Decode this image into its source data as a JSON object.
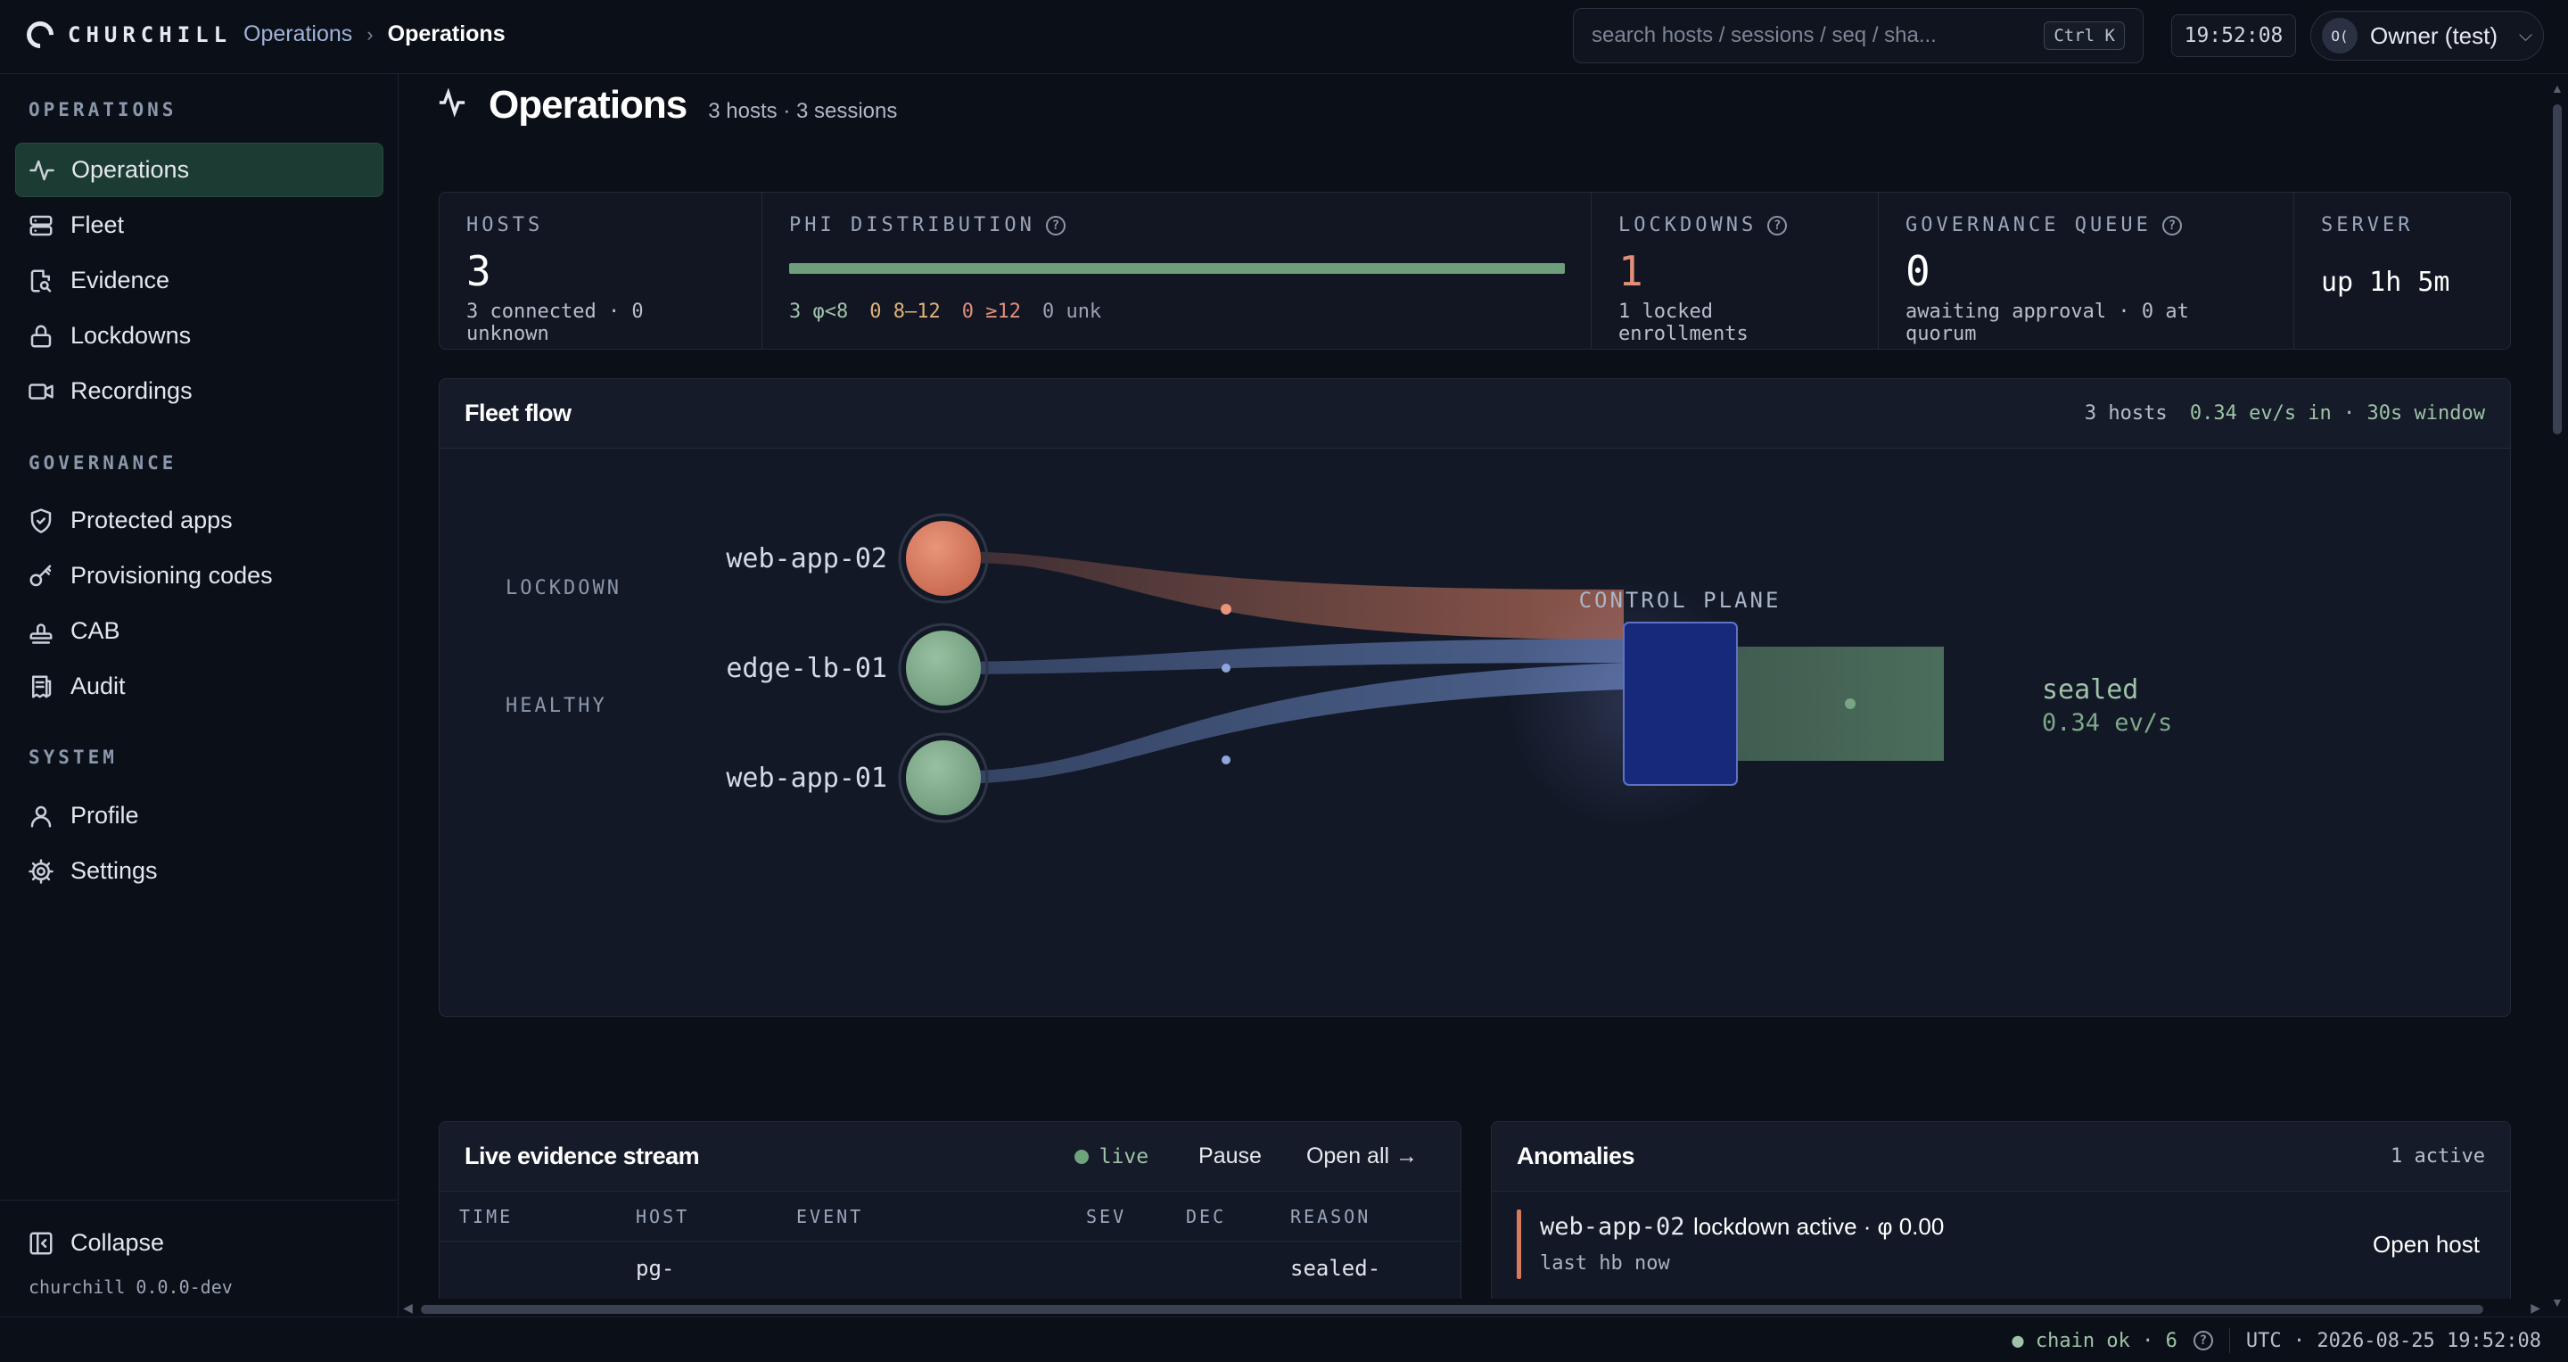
{
  "app": {
    "name": "CHURCHILL"
  },
  "breadcrumb": {
    "parent": "Operations",
    "separator": "›",
    "current": "Operations"
  },
  "search": {
    "placeholder": "search hosts / sessions / seq / sha...",
    "shortcut": "Ctrl K"
  },
  "clock": "19:52:08",
  "user": {
    "initials": "O(",
    "name": "Owner (test)"
  },
  "sidebar": {
    "sections": [
      {
        "title": "OPERATIONS",
        "items": [
          {
            "label": "Operations",
            "icon": "activity-icon",
            "active": true
          },
          {
            "label": "Fleet",
            "icon": "server-icon"
          },
          {
            "label": "Evidence",
            "icon": "file-search-icon"
          },
          {
            "label": "Lockdowns",
            "icon": "lock-icon"
          },
          {
            "label": "Recordings",
            "icon": "video-icon"
          }
        ]
      },
      {
        "title": "GOVERNANCE",
        "items": [
          {
            "label": "Protected apps",
            "icon": "shield-check-icon"
          },
          {
            "label": "Provisioning codes",
            "icon": "key-icon"
          },
          {
            "label": "CAB",
            "icon": "stamp-icon"
          },
          {
            "label": "Audit",
            "icon": "receipt-icon"
          }
        ]
      },
      {
        "title": "SYSTEM",
        "items": [
          {
            "label": "Profile",
            "icon": "user-icon"
          },
          {
            "label": "Settings",
            "icon": "gear-icon"
          }
        ]
      }
    ],
    "collapse_label": "Collapse",
    "version": "churchill 0.0.0-dev"
  },
  "page": {
    "title": "Operations",
    "subtitle": "3 hosts · 3 sessions"
  },
  "stats": {
    "hosts": {
      "label": "HOSTS",
      "value": "3",
      "sub": "3 connected · 0 unknown"
    },
    "phi": {
      "label": "PHI DISTRIBUTION",
      "healthy": "3 φ<8",
      "mid": "0 8–12",
      "high": "0 ≥12",
      "unknown": "0 unk",
      "healthy_fraction": 1.0
    },
    "lockdowns": {
      "label": "LOCKDOWNS",
      "value": "1",
      "sub": "1 locked enrollments"
    },
    "governance": {
      "label": "GOVERNANCE QUEUE",
      "value": "0",
      "sub": "awaiting approval · 0 at quorum"
    },
    "server": {
      "label": "SERVER",
      "value": "up 1h 5m"
    }
  },
  "fleet_flow": {
    "title": "Fleet flow",
    "meta_hosts": "3 hosts",
    "meta_rate": "0.34 ev/s in · 30s window",
    "group_lockdown": "LOCKDOWN",
    "group_healthy": "HEALTHY",
    "hosts": [
      {
        "name": "web-app-02",
        "state": "lockdown"
      },
      {
        "name": "edge-lb-01",
        "state": "healthy"
      },
      {
        "name": "web-app-01",
        "state": "healthy"
      }
    ],
    "control_plane_label": "CONTROL PLANE",
    "sink_label": "sealed",
    "sink_rate": "0.34 ev/s",
    "colors": {
      "lockdown": "#d27a5f",
      "healthy": "#7fa88a",
      "flow": "#4f6592",
      "control": "#17297a"
    }
  },
  "stream": {
    "title": "Live evidence stream",
    "live_label": "live",
    "pause_label": "Pause",
    "open_all_label": "Open all →",
    "columns": [
      "TIME",
      "HOST",
      "EVENT",
      "SEV",
      "DEC",
      "REASON"
    ],
    "rows": [
      {
        "time": "",
        "host": "pg-",
        "event": "",
        "sev": "",
        "dec": "",
        "reason": "sealed-"
      }
    ]
  },
  "anomalies": {
    "title": "Anomalies",
    "count": "1 active",
    "items": [
      {
        "host": "web-app-02",
        "desc": "lockdown active · φ 0.00",
        "sub": "last hb now",
        "action": "Open host"
      }
    ]
  },
  "status": {
    "chain": "● chain ok · 6",
    "timestamp": "UTC · 2026-08-25 19:52:08"
  }
}
